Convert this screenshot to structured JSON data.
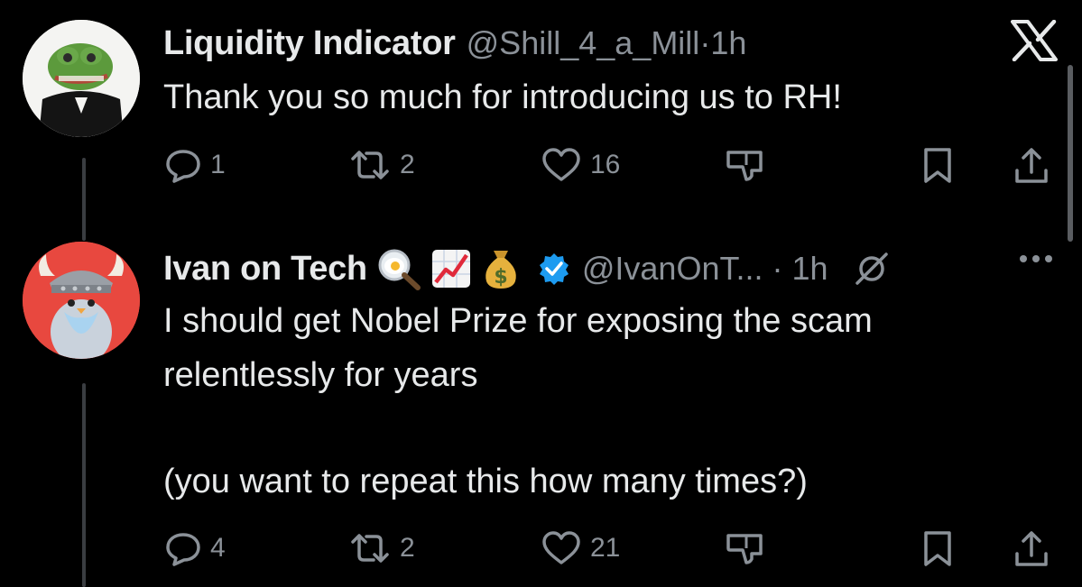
{
  "tweets": [
    {
      "name": "Liquidity Indicator",
      "handle": "@Shill_4_a_Mill",
      "time": "1h",
      "text": "Thank you so much for introducing us to RH!",
      "replies": "1",
      "retweets": "2",
      "likes": "16"
    },
    {
      "name": "Ivan on Tech",
      "handle": "@IvanOnT...",
      "time": "1h",
      "text_line1": "I should get Nobel Prize for exposing the scam",
      "text_line2": "relentlessly for years",
      "text_line3": "(you want to repeat this how many times?)",
      "emojis": [
        "magnifier-egg",
        "chart-increasing",
        "money-bag"
      ],
      "verified": true,
      "replies": "4",
      "retweets": "2",
      "likes": "21"
    }
  ],
  "separator": "·",
  "colors": {
    "background": "#000000",
    "text": "#e7e9ea",
    "muted": "#8b9198",
    "verified": "#1d9bf0"
  },
  "icons": [
    "x-logo-icon",
    "reply-icon",
    "retweet-icon",
    "like-icon",
    "views-icon",
    "bookmark-icon",
    "share-icon",
    "grok-icon",
    "more-icon"
  ]
}
